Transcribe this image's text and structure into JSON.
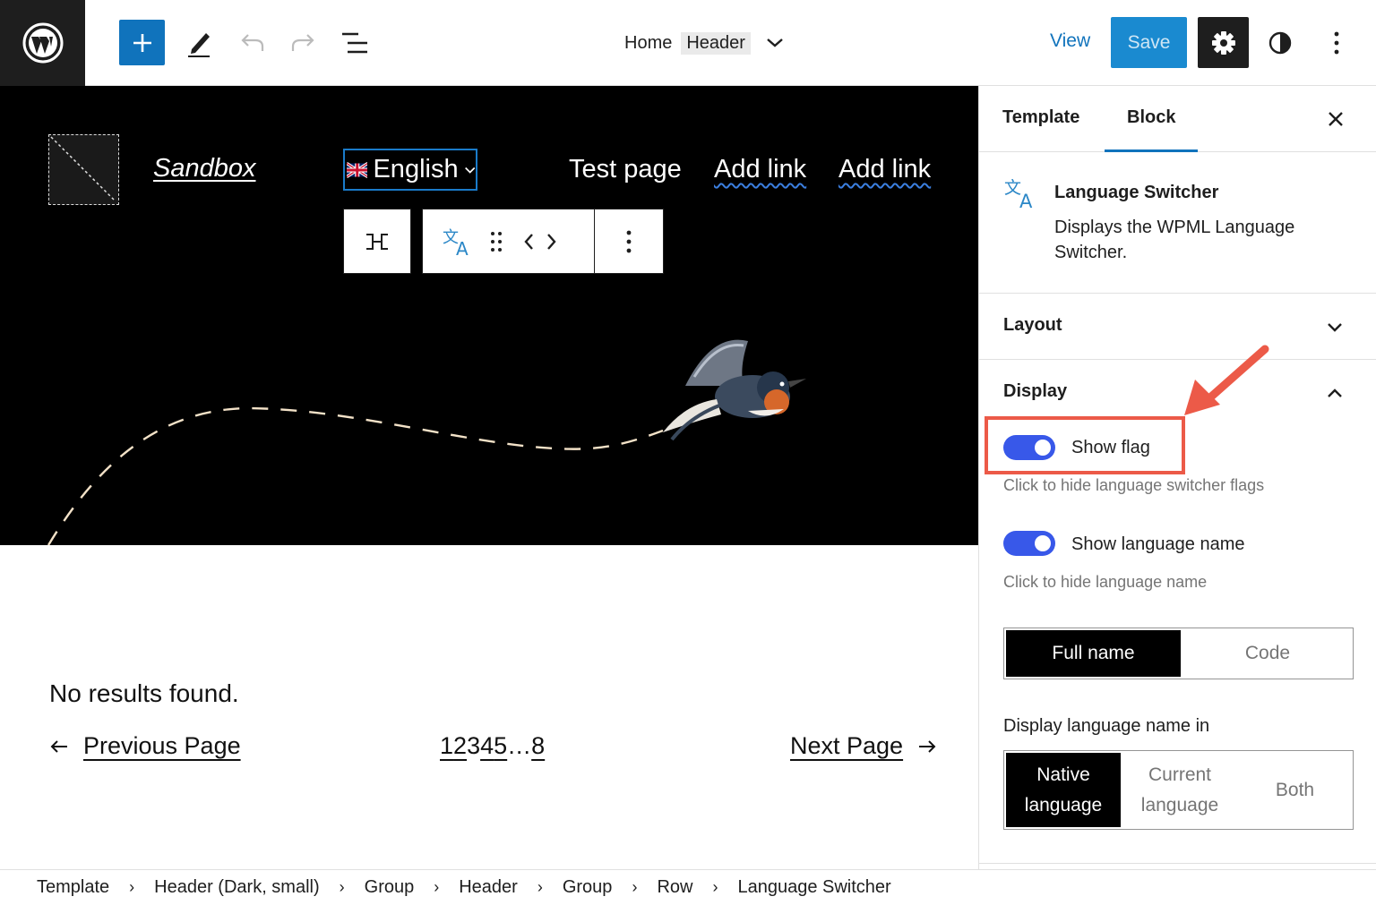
{
  "topbar": {
    "doc_home": "Home",
    "doc_template": "Header",
    "view_label": "View",
    "save_label": "Save"
  },
  "canvas": {
    "site_title": "Sandbox",
    "language": "English",
    "nav": [
      "Test page",
      "Add link",
      "Add link"
    ],
    "no_results": "No results found.",
    "prev_label": "Previous Page",
    "next_label": "Next Page",
    "pages": [
      "1",
      "2",
      "3",
      "4",
      "5",
      "…",
      "8"
    ],
    "current_page": "3"
  },
  "sidebar": {
    "tabs": [
      "Template",
      "Block"
    ],
    "active_tab": "Block",
    "block_name": "Language Switcher",
    "block_desc": "Displays the WPML Language Switcher.",
    "layout_label": "Layout",
    "display_label": "Display",
    "show_flag_label": "Show flag",
    "show_flag_help": "Click to hide language switcher flags",
    "show_flag_on": true,
    "show_name_label": "Show language name",
    "show_name_help": "Click to hide language name",
    "show_name_on": true,
    "name_format": {
      "options": [
        "Full name",
        "Code"
      ],
      "selected": "Full name"
    },
    "display_in_label": "Display language name in",
    "display_in": {
      "options": [
        "Native language",
        "Current language",
        "Both"
      ],
      "selected": "Native language"
    }
  },
  "breadcrumb": [
    "Template",
    "Header (Dark, small)",
    "Group",
    "Header",
    "Group",
    "Row",
    "Language Switcher"
  ],
  "colors": {
    "accent": "#1073bc",
    "toggle": "#3858e9",
    "highlight": "#ec5a48"
  }
}
